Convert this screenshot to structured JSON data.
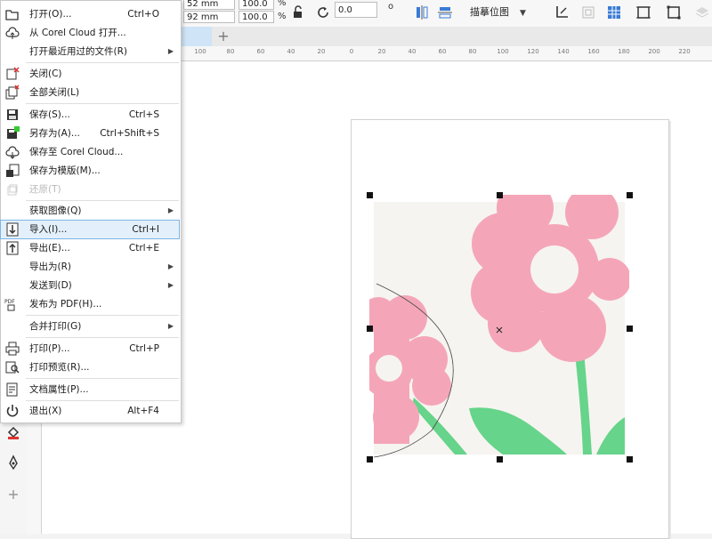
{
  "property_bar": {
    "y_size": "92 mm",
    "x_size_partial": "52 mm",
    "scale_w": "100.0",
    "scale_h": "100.0",
    "percent_1": "%",
    "percent_2": "%",
    "rotation": "0.0",
    "degree": "o",
    "trace_label": "描摹位图",
    "trace_caret": "▼"
  },
  "ruler_labels": [
    "100",
    "80",
    "60",
    "40",
    "20",
    "0",
    "20",
    "40",
    "60",
    "80",
    "100",
    "120",
    "140",
    "160",
    "180",
    "200",
    "220"
  ],
  "file_menu": {
    "items": [
      {
        "label": "打开(O)...",
        "shortcut": "Ctrl+O",
        "icon": "folder-open-icon"
      },
      {
        "label": "从 Corel Cloud 打开...",
        "shortcut": "",
        "icon": "cloud-open-icon"
      },
      {
        "label": "打开最近用过的文件(R)",
        "shortcut": "",
        "icon": "",
        "submenu": true
      },
      {
        "label": "关闭(C)",
        "shortcut": "",
        "icon": "close-doc-icon"
      },
      {
        "label": "全部关闭(L)",
        "shortcut": "",
        "icon": "close-all-icon"
      },
      {
        "label": "保存(S)...",
        "shortcut": "Ctrl+S",
        "icon": "save-icon"
      },
      {
        "label": "另存为(A)...",
        "shortcut": "Ctrl+Shift+S",
        "icon": "save-as-icon"
      },
      {
        "label": "保存至 Corel Cloud...",
        "shortcut": "",
        "icon": "cloud-save-icon"
      },
      {
        "label": "保存为模版(M)...",
        "shortcut": "",
        "icon": "save-template-icon"
      },
      {
        "label": "还原(T)",
        "shortcut": "",
        "icon": "revert-icon",
        "disabled": true
      },
      {
        "label": "获取图像(Q)",
        "shortcut": "",
        "icon": "",
        "submenu": true
      },
      {
        "label": "导入(I)...",
        "shortcut": "Ctrl+I",
        "icon": "import-icon",
        "highlighted": true
      },
      {
        "label": "导出(E)...",
        "shortcut": "Ctrl+E",
        "icon": "export-icon"
      },
      {
        "label": "导出为(R)",
        "shortcut": "",
        "icon": "",
        "submenu": true
      },
      {
        "label": "发送到(D)",
        "shortcut": "",
        "icon": "",
        "submenu": true
      },
      {
        "label": "发布为 PDF(H)...",
        "shortcut": "",
        "icon": "pdf-icon"
      },
      {
        "label": "合并打印(G)",
        "shortcut": "",
        "icon": "",
        "submenu": true
      },
      {
        "label": "打印(P)...",
        "shortcut": "Ctrl+P",
        "icon": "print-icon"
      },
      {
        "label": "打印预览(R)...",
        "shortcut": "",
        "icon": "print-preview-icon"
      },
      {
        "label": "文档属性(P)...",
        "shortcut": "",
        "icon": "document-properties-icon"
      },
      {
        "label": "退出(X)",
        "shortcut": "Alt+F4",
        "icon": "power-icon"
      }
    ],
    "submenu_arrow": "▶"
  },
  "tab_plus": "+",
  "colors": {
    "highlight_bg": "#e3f0fb",
    "highlight_border": "#7fb4e3",
    "flower_pink": "#f4a6b8",
    "leaf_green": "#66d48a",
    "art_bg": "#f6f4f0"
  }
}
